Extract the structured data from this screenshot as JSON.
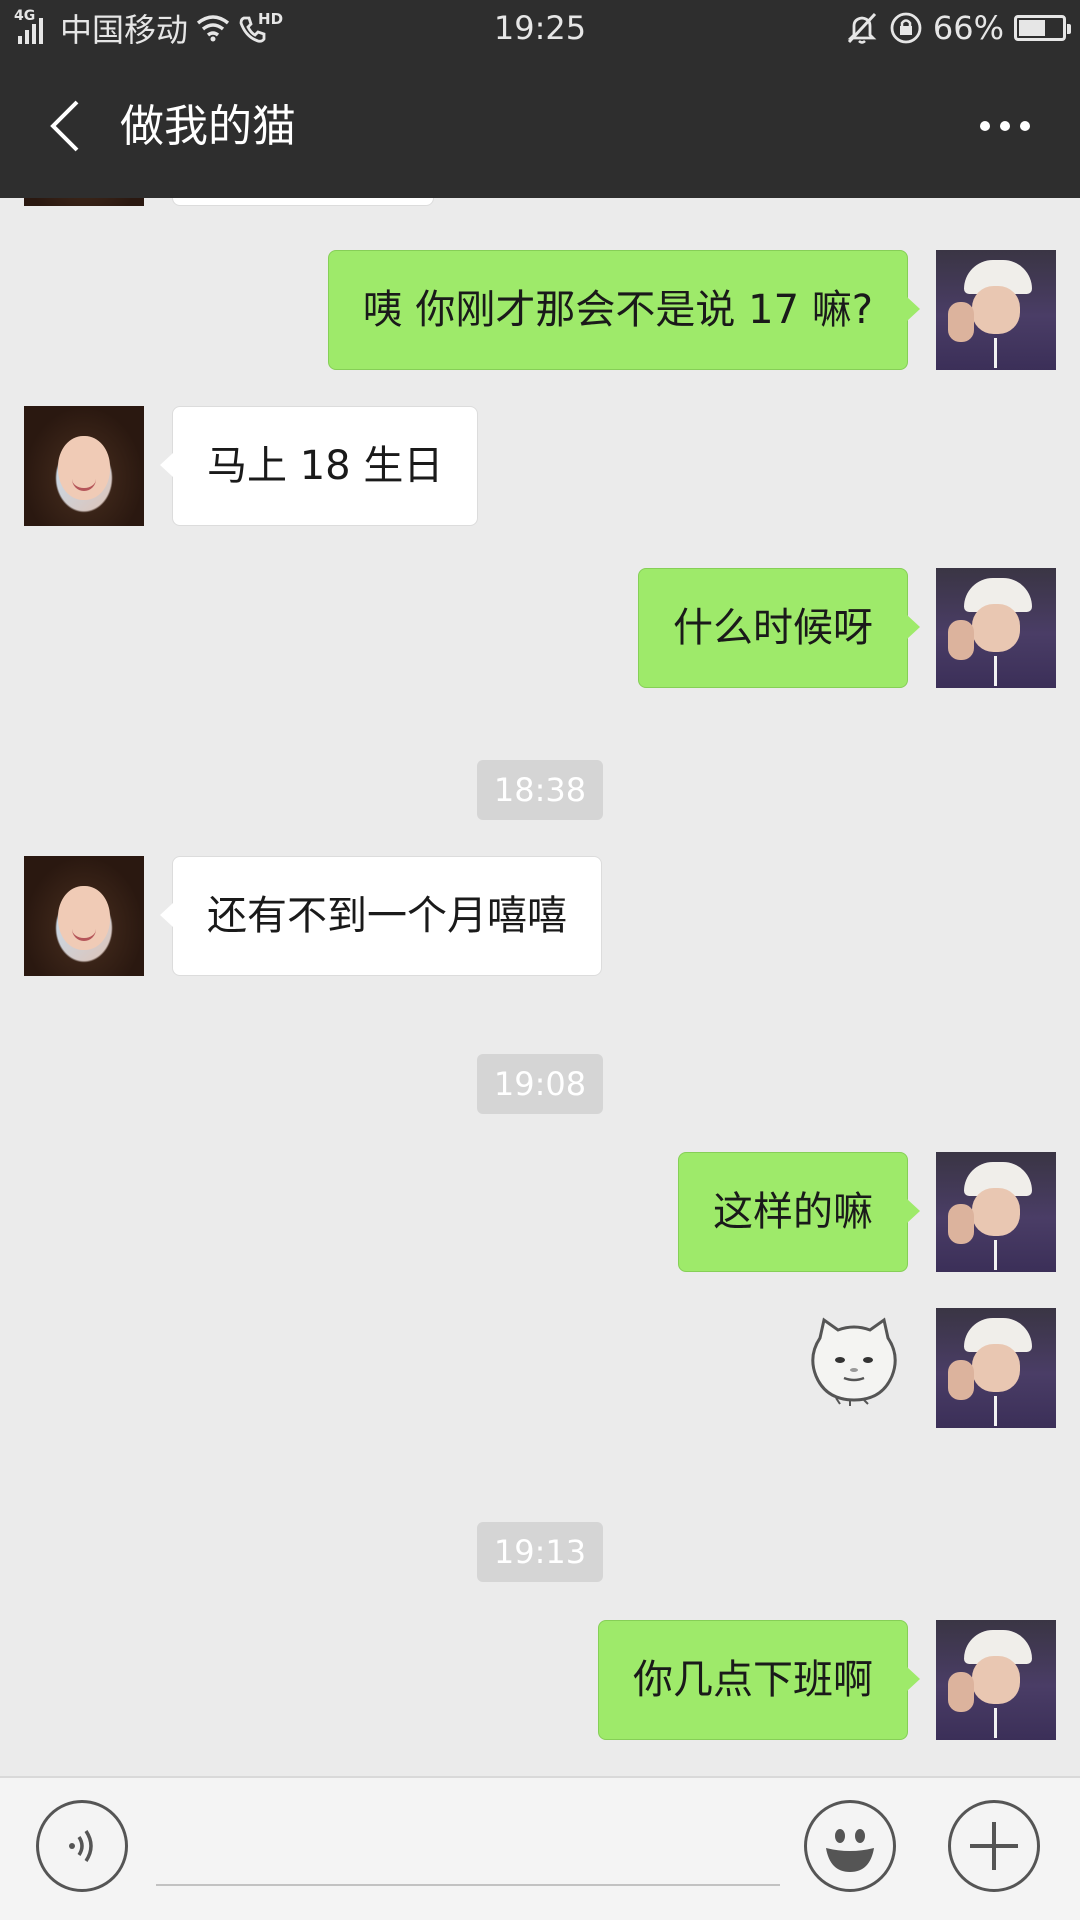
{
  "status_bar": {
    "network": "4G",
    "carrier": "中国移动",
    "call_badge": "HD",
    "time": "19:25",
    "battery_percent": "66%",
    "battery_level": 0.66,
    "icons": [
      "signal-icon",
      "wifi-icon",
      "hd-call-icon",
      "mute-icon",
      "rotation-lock-icon",
      "battery-icon"
    ]
  },
  "header": {
    "title": "做我的猫",
    "icons": [
      "back-arrow-icon",
      "more-dots-icon"
    ]
  },
  "messages": [
    {
      "side": "right",
      "type": "text",
      "text": "咦  你刚才那会不是说 17 嘛?"
    },
    {
      "side": "left",
      "type": "text",
      "text": "马上 18 生日"
    },
    {
      "side": "right",
      "type": "text",
      "text": "什么时候呀"
    },
    {
      "type": "time",
      "text": "18:38"
    },
    {
      "side": "left",
      "type": "text",
      "text": "还有不到一个月嘻嘻"
    },
    {
      "type": "time",
      "text": "19:08"
    },
    {
      "side": "right",
      "type": "text",
      "text": "这样的嘛"
    },
    {
      "side": "right",
      "type": "sticker",
      "icon": "sticker-face-icon"
    },
    {
      "type": "time",
      "text": "19:13"
    },
    {
      "side": "right",
      "type": "text",
      "text": "你几点下班啊"
    }
  ],
  "input_bar": {
    "input_value": "",
    "icons": [
      "voice-icon",
      "emoji-icon",
      "plus-icon"
    ]
  }
}
